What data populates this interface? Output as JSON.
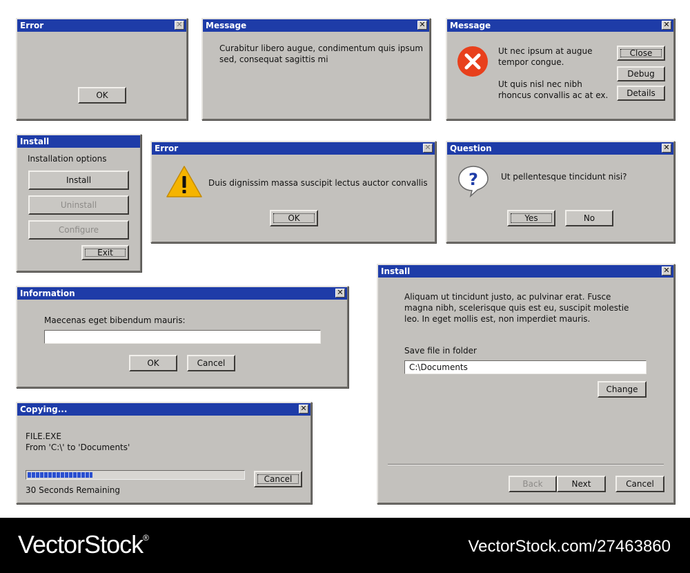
{
  "dialogs": {
    "error1": {
      "title": "Error",
      "ok": "OK"
    },
    "message1": {
      "title": "Message",
      "text": "Curabitur libero augue, condimentum quis ipsum sed, consequat sagittis mi"
    },
    "message2": {
      "title": "Message",
      "text1": "Ut nec ipsum at augue tempor congue.",
      "text2": "Ut quis nisl nec nibh rhoncus convallis ac at ex.",
      "buttons": {
        "close": "Close",
        "debug": "Debug",
        "details": "Details"
      }
    },
    "install1": {
      "title": "Install",
      "heading": "Installation options",
      "buttons": {
        "install": "Install",
        "uninstall": "Uninstall",
        "configure": "Configure",
        "exit": "Exit"
      }
    },
    "error2": {
      "title": "Error",
      "text": "Duis dignissim massa suscipit lectus auctor convallis",
      "ok": "OK"
    },
    "question": {
      "title": "Question",
      "text": "Ut pellentesque tincidunt nisi?",
      "yes": "Yes",
      "no": "No"
    },
    "information": {
      "title": "Information",
      "prompt": "Maecenas eget bibendum mauris:",
      "input_value": "",
      "ok": "OK",
      "cancel": "Cancel"
    },
    "copying": {
      "title": "Copying...",
      "file": "FILE.EXE",
      "from": "From 'C:\\' to 'Documents'",
      "progress": 0.3,
      "remaining": "30 Seconds Remaining",
      "cancel": "Cancel"
    },
    "install2": {
      "title": "Install",
      "text": "Aliquam ut tincidunt justo, ac pulvinar erat. Fusce magna nibh, scelerisque quis est eu, suscipit molestie leo. In eget mollis est, non imperdiet mauris.",
      "folder_label": "Save file in folder",
      "folder_value": "C:\\Documents",
      "change": "Change",
      "back": "Back",
      "next": "Next",
      "cancel": "Cancel"
    }
  },
  "icons": {
    "error": "error-x-icon",
    "warning": "warning-icon",
    "question": "question-icon",
    "close": "close-icon"
  },
  "colors": {
    "titlebar": "#1e3ca8",
    "window": "#c3c1bd",
    "error_icon": "#e8401c",
    "warning_icon": "#f5b400",
    "question_icon": "#1e3ca8",
    "progress": "#2a4fd0"
  },
  "watermark": {
    "brand": "VectorStock",
    "trademark": "®",
    "id": "VectorStock.com/27463860"
  }
}
